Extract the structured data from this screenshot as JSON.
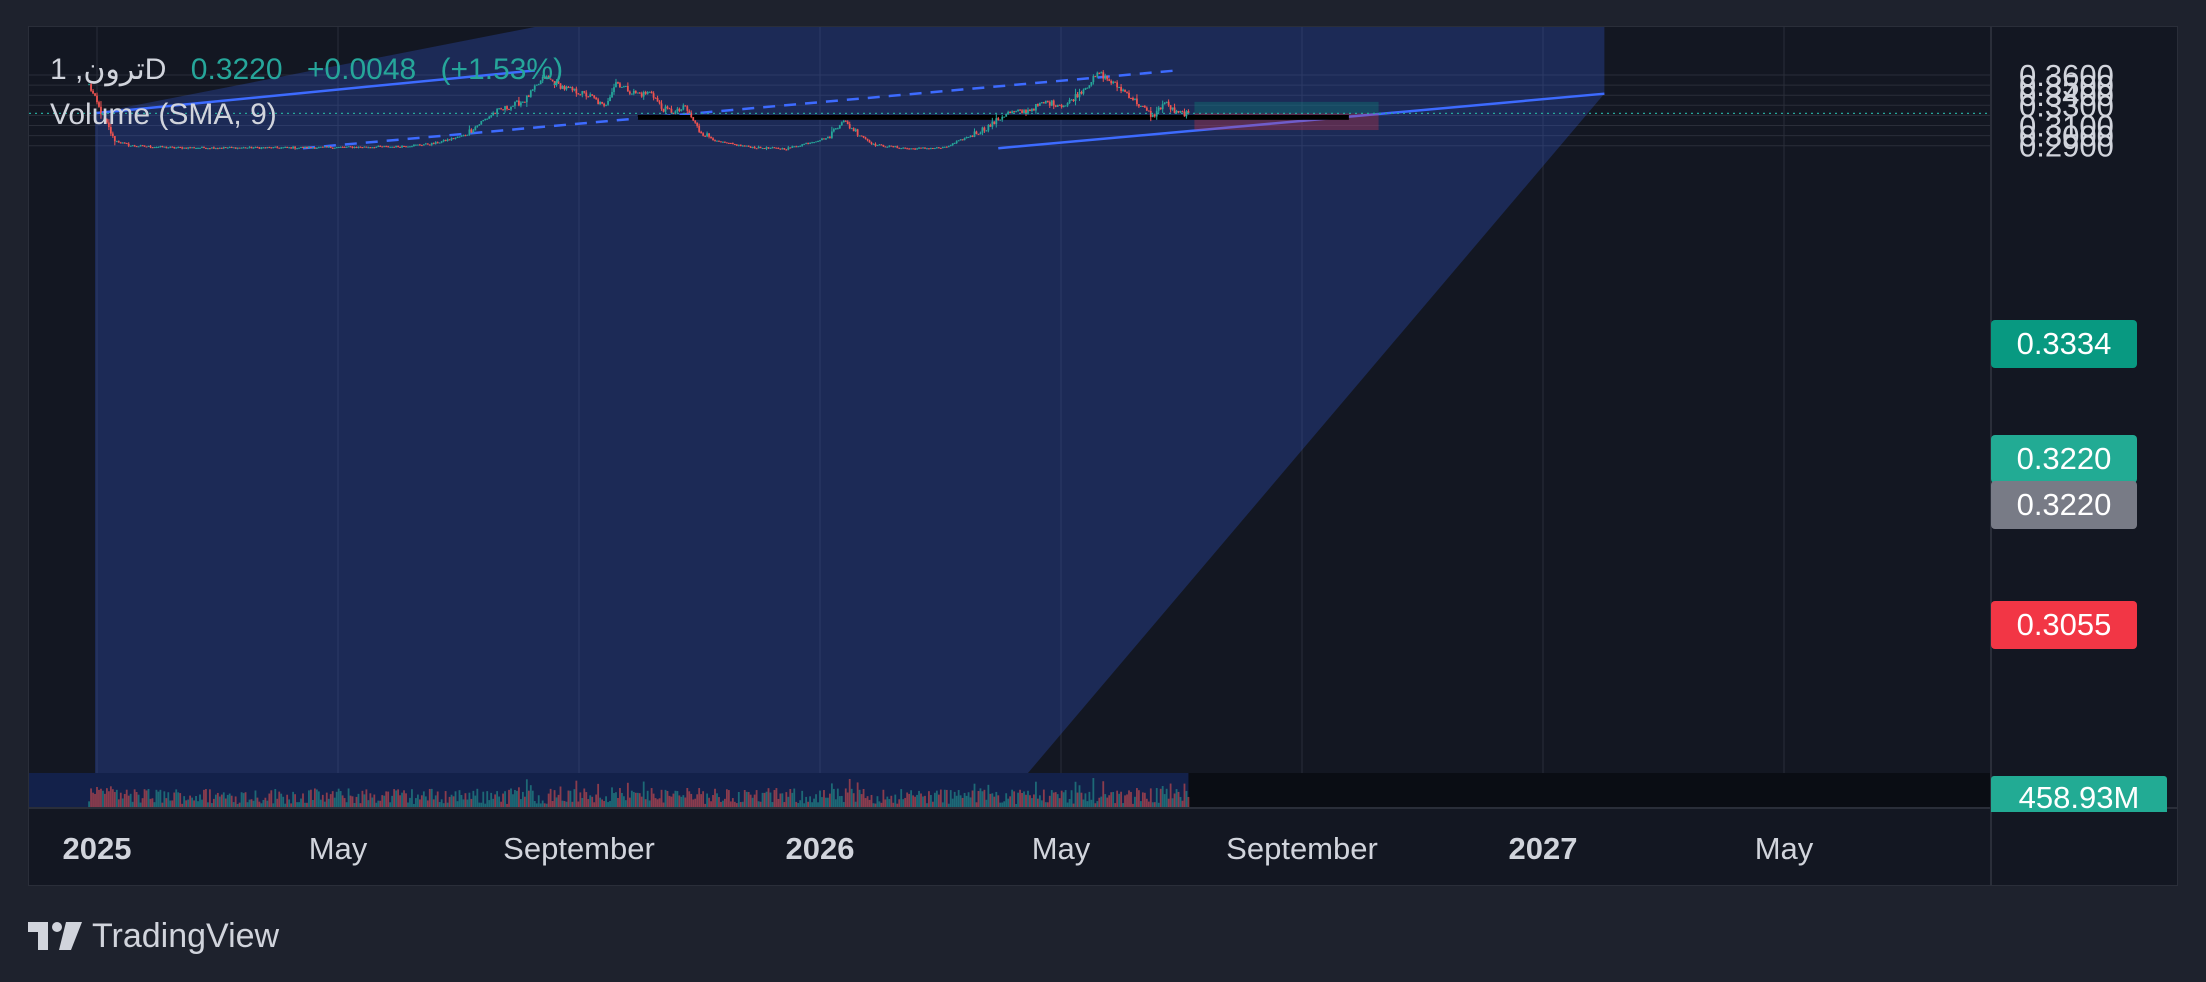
{
  "legend": {
    "symbol": "ترون, 1D",
    "close": "0.3220",
    "change": "+0.0048",
    "change_pct": "(+1.53%)",
    "indicator": "Volume (SMA, 9)"
  },
  "price_axis": {
    "ticks": [
      "0.3600",
      "0.3500",
      "0.3400",
      "0.3300",
      "0.3100",
      "0.3000",
      "0.2900"
    ],
    "labels": {
      "target": "0.3334",
      "last": "0.3220",
      "entry": "0.3220",
      "stop": "0.3055",
      "volume": "458.93M"
    }
  },
  "time_axis": {
    "ticks": [
      "2025",
      "May",
      "September",
      "2026",
      "May",
      "September",
      "2027",
      "May"
    ],
    "bold": [
      true,
      false,
      false,
      true,
      false,
      false,
      true,
      false
    ]
  },
  "colors": {
    "up": "#26a69a",
    "down": "#ef5350",
    "target_badge": "#089981",
    "last_badge": "#22ab94",
    "entry_badge": "#787b86",
    "stop_badge": "#f23645",
    "channel": "#3d6bff",
    "background": "#131722",
    "page": "#1e222d"
  },
  "chart_data": {
    "type": "candlestick",
    "symbol": "ترون",
    "interval": "1D",
    "x_range": [
      "2024-12",
      "2027-07"
    ],
    "ylim": [
      0.2875,
      0.3645
    ],
    "last_price": 0.322,
    "price_path": [
      [
        "2024-12-28",
        0.35
      ],
      [
        "2025-01-03",
        0.323
      ],
      [
        "2025-01-10",
        0.295
      ],
      [
        "2025-01-18",
        0.29
      ],
      [
        "2025-02-10",
        0.288
      ],
      [
        "2025-04-10",
        0.288
      ],
      [
        "2025-06-01",
        0.289
      ],
      [
        "2025-06-20",
        0.292
      ],
      [
        "2025-07-05",
        0.3
      ],
      [
        "2025-07-20",
        0.322
      ],
      [
        "2025-08-05",
        0.335
      ],
      [
        "2025-08-15",
        0.358
      ],
      [
        "2025-08-25",
        0.347
      ],
      [
        "2025-09-01",
        0.343
      ],
      [
        "2025-09-08",
        0.338
      ],
      [
        "2025-09-14",
        0.328
      ],
      [
        "2025-09-20",
        0.353
      ],
      [
        "2025-09-28",
        0.343
      ],
      [
        "2025-10-03",
        0.341
      ],
      [
        "2025-10-08",
        0.343
      ],
      [
        "2025-10-13",
        0.327
      ],
      [
        "2025-10-20",
        0.323
      ],
      [
        "2025-10-25",
        0.328
      ],
      [
        "2025-11-01",
        0.305
      ],
      [
        "2025-11-10",
        0.294
      ],
      [
        "2025-11-22",
        0.29
      ],
      [
        "2025-11-30",
        0.288
      ],
      [
        "2025-12-15",
        0.287
      ],
      [
        "2026-01-05",
        0.298
      ],
      [
        "2026-01-12",
        0.315
      ],
      [
        "2026-01-18",
        0.306
      ],
      [
        "2026-01-28",
        0.291
      ],
      [
        "2026-02-15",
        0.287
      ],
      [
        "2026-03-05",
        0.288
      ],
      [
        "2026-03-18",
        0.3
      ],
      [
        "2026-03-28",
        0.31
      ],
      [
        "2026-04-05",
        0.322
      ],
      [
        "2026-04-15",
        0.324
      ],
      [
        "2026-04-25",
        0.333
      ],
      [
        "2026-05-05",
        0.33
      ],
      [
        "2026-05-15",
        0.348
      ],
      [
        "2026-05-22",
        0.362
      ],
      [
        "2026-05-28",
        0.353
      ],
      [
        "2026-06-05",
        0.342
      ],
      [
        "2026-06-12",
        0.329
      ],
      [
        "2026-06-18",
        0.319
      ],
      [
        "2026-06-24",
        0.333
      ],
      [
        "2026-06-30",
        0.322
      ],
      [
        "2026-07-06",
        0.322
      ]
    ],
    "volume": {
      "last": "458.93M",
      "sma_period": 9
    },
    "channel": {
      "lower": [
        [
          "2026-04-01",
          0.2875
        ],
        [
          "2027-02-01",
          0.3415
        ]
      ],
      "upper": [
        [
          "2024-12-31",
          0.3222
        ],
        [
          "2025-08-10",
          0.3645
        ]
      ],
      "middle": [
        [
          "2025-04-15",
          0.2875
        ],
        [
          "2026-06-30",
          0.3645
        ]
      ]
    },
    "position": {
      "type": "long",
      "entry": 0.322,
      "target": 0.3334,
      "stop": 0.3055,
      "start": "2026-07-06",
      "end": "2026-10-10"
    },
    "zone": {
      "top": 0.3204,
      "bottom": 0.3156,
      "start": "2025-10-01",
      "end": "2026-09-25"
    }
  },
  "footer": {
    "brand": "TradingView"
  }
}
